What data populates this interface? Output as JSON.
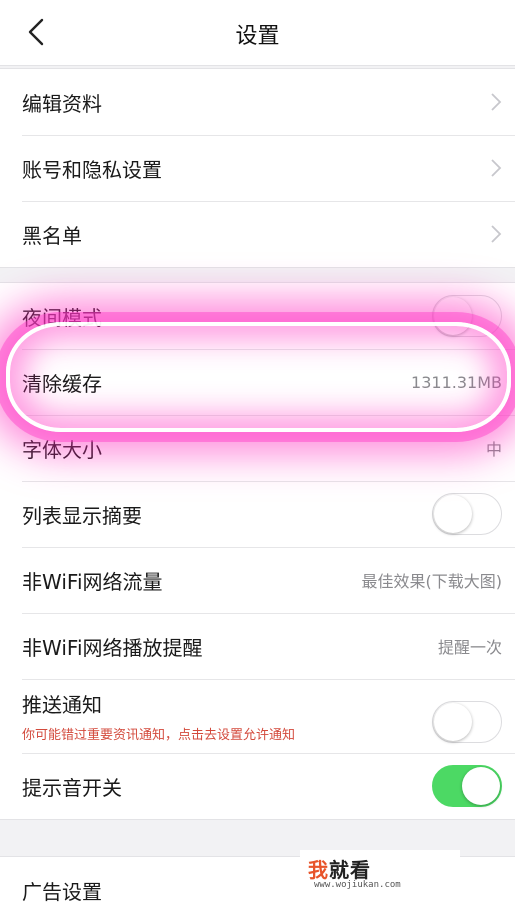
{
  "nav": {
    "title": "设置",
    "back_icon": "chevron-left-icon"
  },
  "group1": [
    {
      "id": "edit-profile",
      "label": "编辑资料"
    },
    {
      "id": "account-privacy",
      "label": "账号和隐私设置"
    },
    {
      "id": "blacklist",
      "label": "黑名单"
    }
  ],
  "group2": {
    "night_mode": {
      "label": "夜间模式",
      "on": false
    },
    "clear_cache": {
      "label": "清除缓存",
      "value": "1311.31MB"
    },
    "font_size": {
      "label": "字体大小",
      "value": "中"
    },
    "list_summary": {
      "label": "列表显示摘要",
      "on": false
    },
    "non_wifi_traffic": {
      "label": "非WiFi网络流量",
      "value": "最佳效果(下载大图)"
    },
    "non_wifi_play": {
      "label": "非WiFi网络播放提醒",
      "value": "提醒一次"
    },
    "push": {
      "label": "推送通知",
      "hint": "你可能错过重要资讯通知，点击去设置允许通知",
      "on": false
    },
    "sound": {
      "label": "提示音开关",
      "on": true
    }
  },
  "group3": {
    "ad_settings": {
      "label": "广告设置"
    }
  },
  "watermark": {
    "main_accent": "我",
    "main_rest": "就看",
    "sub": "www.wojiukan.com"
  },
  "colors": {
    "toggle_on": "#4cd964",
    "hint_red": "#d34a3c",
    "highlight": "#ff3cc8"
  }
}
